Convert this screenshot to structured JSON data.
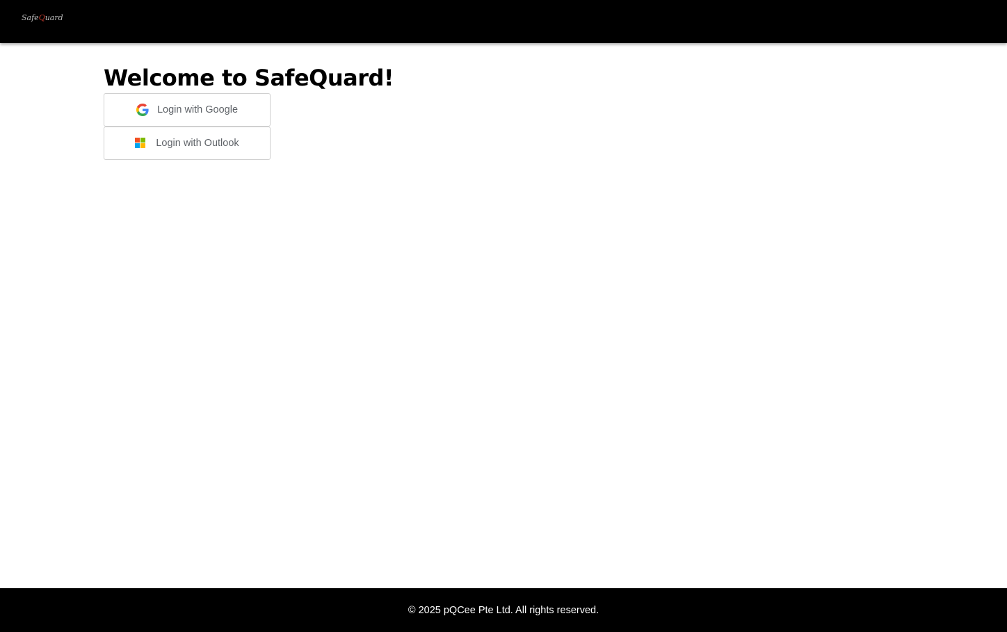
{
  "header": {
    "logo_prefix": "Safe",
    "logo_q": "Q",
    "logo_suffix": "uard"
  },
  "main": {
    "title": "Welcome to SafeQuard!",
    "buttons": [
      {
        "label": "Login with Google",
        "icon": "google-icon"
      },
      {
        "label": "Login with Outlook",
        "icon": "microsoft-icon"
      }
    ]
  },
  "footer": {
    "copyright": "© 2025 pQCee Pte Ltd. All rights reserved."
  },
  "colors": {
    "header_bg": "#000000",
    "footer_bg": "#000000",
    "logo_accent": "#c0392b",
    "button_text": "#5f6368"
  }
}
